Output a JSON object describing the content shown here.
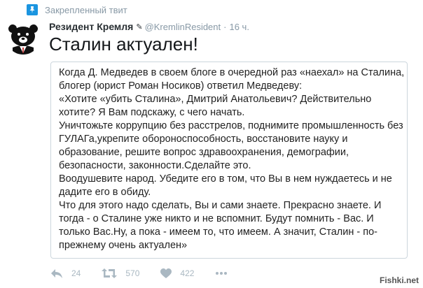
{
  "pinned": {
    "label": "Закрепленный твит"
  },
  "author": {
    "name": "Резидент Кремля",
    "handle": "@KremlinResident",
    "separator": "·",
    "time": "16 ч."
  },
  "tweet": {
    "text": "Сталин актуален!",
    "image_lines": [
      "Когда Д. Медведев в своем блоге в очередной раз «наехал» на Сталина,",
      "блогер (юрист Роман Носиков) ответил Медведеву:",
      "«Хотите «убить Сталина», Дмитрий Анатольевич? Действительно",
      "хотите? Я Вам подскажу, с чего начать.",
      "Уничтожьте коррупцию без расстрелов, поднимите промышленность без",
      "ГУЛАГа,укрепите обороноспособность, восстановите науку и",
      "образование, решите вопрос здравоохранения, демографии,",
      "безопасности, законности.Сделайте это.",
      "Воодушевите народ. Убедите его в том, что Вы в нем нуждаетесь и не",
      "дадите его в обиду.",
      "Что для этого надо сделать, Вы и сами знаете. Прекрасно знаете. И",
      "тогда - о Сталине уже никто и не вспомнит. Будут помнить - Вас. И",
      "только Вас.Ну, а пока - имеем то, что имеем. А значит, Сталин - по-",
      "прежнему очень актуален»"
    ]
  },
  "actions": {
    "replies": "24",
    "retweets": "570",
    "likes": "422"
  },
  "watermark": "Fishki.net",
  "colors": {
    "pin_badge": "#1b95e0",
    "muted": "#8899a6",
    "action_icon": "#aab8c2"
  }
}
